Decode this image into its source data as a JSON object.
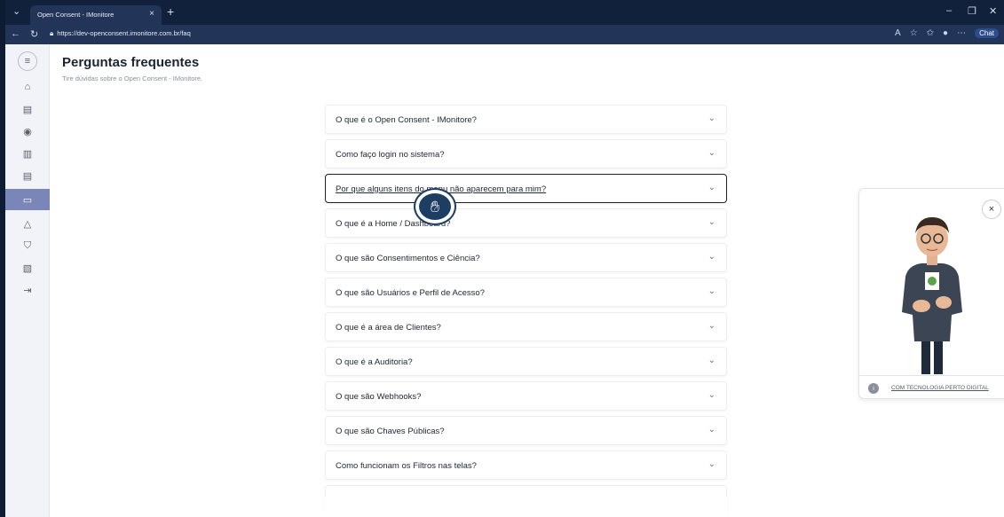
{
  "browser": {
    "tab_title": "Open Consent - IMonitore",
    "tab_close": "×",
    "new_tab": "+",
    "url": "https://dev-openconsent.imonitore.com.br/faq",
    "chat_label": "Chat"
  },
  "page": {
    "title": "Perguntas frequentes",
    "subtitle": "Tire dúvidas sobre o Open Consent - IMonitore."
  },
  "sidebar": {
    "items": [
      {
        "icon": "home-icon",
        "glyph": "⌂"
      },
      {
        "icon": "document-icon",
        "glyph": "▤"
      },
      {
        "icon": "eye-icon",
        "glyph": "◉"
      },
      {
        "icon": "clipboard-icon",
        "glyph": "▥"
      },
      {
        "icon": "file-icon",
        "glyph": "▤"
      },
      {
        "icon": "chat-icon",
        "glyph": "▭"
      },
      {
        "icon": "warning-icon",
        "glyph": "△"
      },
      {
        "icon": "shield-icon",
        "glyph": "⛉"
      },
      {
        "icon": "report-icon",
        "glyph": "▧"
      },
      {
        "icon": "logout-icon",
        "glyph": "⇥"
      }
    ]
  },
  "faq": [
    {
      "question": "O que é o Open Consent - IMonitore?"
    },
    {
      "question": "Como faço login no sistema?"
    },
    {
      "question": "Por que alguns itens do menu não aparecem para mim?"
    },
    {
      "question": "O que é a Home / Dashboard?"
    },
    {
      "question": "O que são Consentimentos e Ciência?"
    },
    {
      "question": "O que são Usuários e Perfil de Acesso?"
    },
    {
      "question": "O que é a área de Clientes?"
    },
    {
      "question": "O que é a Auditoria?"
    },
    {
      "question": "O que são Webhooks?"
    },
    {
      "question": "O que são Chaves Públicas?"
    },
    {
      "question": "Como funcionam os Filtros nas telas?"
    }
  ],
  "widget": {
    "close": "×",
    "footer": "COM TECNOLOGIA PERTO DIGITAL"
  },
  "colors": {
    "accent": "#7b86b8",
    "chrome": "#11203b"
  }
}
